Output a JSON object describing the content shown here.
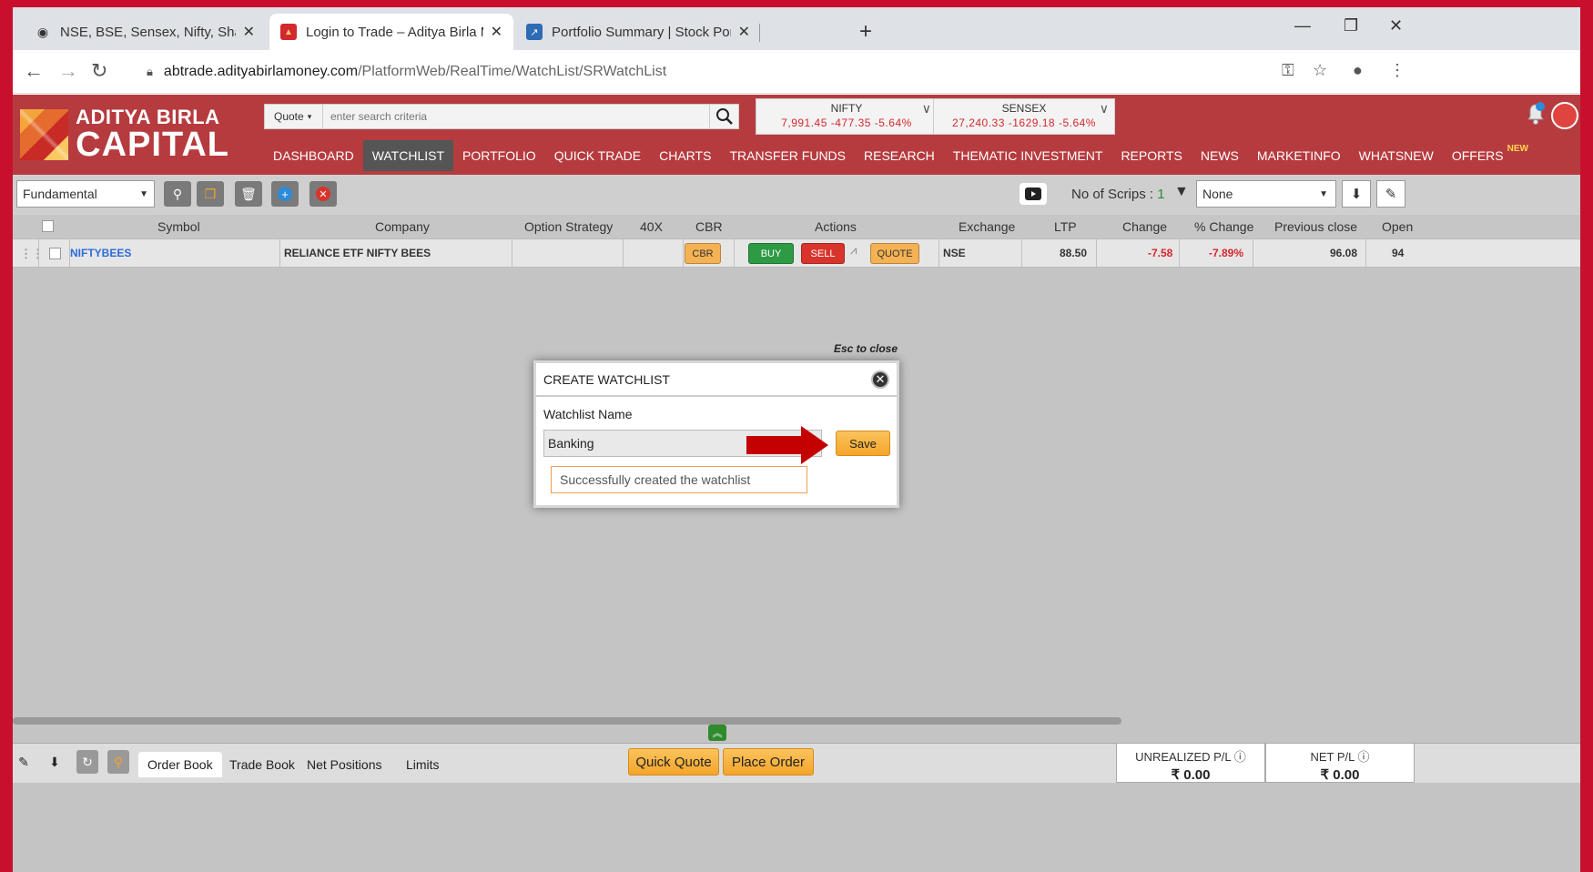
{
  "browser": {
    "tabs": [
      {
        "title": "NSE, BSE, Sensex, Nifty, Share Ma",
        "icon": "globe-icon"
      },
      {
        "title": "Login to Trade – Aditya Birla Mo",
        "icon": "aditya-birla-icon"
      },
      {
        "title": "Portfolio Summary | Stock Portfol",
        "icon": "chart-icon"
      }
    ],
    "url_host": "abtrade.adityabirlamoney.com",
    "url_path": "/PlatformWeb/RealTime/WatchList/SRWatchList"
  },
  "header": {
    "logo_line1": "ADITYA BIRLA",
    "logo_line2": "CAPITAL",
    "search_type": "Quote",
    "search_placeholder": "enter search criteria",
    "indices": [
      {
        "name": "NIFTY",
        "values": "7,991.45  -477.35  -5.64%"
      },
      {
        "name": "SENSEX",
        "values": "27,240.33  -1629.18  -5.64%"
      }
    ],
    "nav": [
      "DASHBOARD",
      "WATCHLIST",
      "PORTFOLIO",
      "QUICK TRADE",
      "CHARTS",
      "TRANSFER FUNDS",
      "RESEARCH",
      "THEMATIC INVESTMENT",
      "REPORTS",
      "NEWS",
      "MARKETINFO",
      "WHATSNEW",
      "OFFERS"
    ],
    "new_badge": "NEW",
    "bell_count": "3"
  },
  "toolbar": {
    "watchlist_selected": "Fundamental",
    "scrips_label": "No of Scrips : ",
    "scrips_count": "1",
    "filter_selected": "None"
  },
  "table": {
    "columns": [
      "Symbol",
      "Company",
      "Option Strategy",
      "40X",
      "CBR",
      "Actions",
      "Exchange",
      "LTP",
      "Change",
      "% Change",
      "Previous close",
      "Open"
    ],
    "rows": [
      {
        "symbol": "NIFTYBEES",
        "company": "RELIANCE ETF NIFTY BEES",
        "cbr_label": "CBR",
        "buy_label": "BUY",
        "sell_label": "SELL",
        "quote_label": "QUOTE",
        "exchange": "NSE",
        "ltp": "88.50",
        "change": "-7.58",
        "pct_change": "-7.89%",
        "prev_close": "96.08",
        "open": "94"
      }
    ]
  },
  "modal": {
    "esc_hint": "Esc to close",
    "title": "CREATE WATCHLIST",
    "name_label": "Watchlist Name",
    "name_value": "Banking",
    "save_label": "Save",
    "success_message": "Successfully created the watchlist"
  },
  "bottom": {
    "tabs": [
      "Order Book",
      "Trade Book",
      "Net Positions",
      "Limits"
    ],
    "quick_quote": "Quick Quote",
    "place_order": "Place Order",
    "unrealized_label": "UNREALIZED P/L",
    "unrealized_value": "₹ 0.00",
    "net_label": "NET P/L",
    "net_value": "₹ 0.00"
  },
  "colors": {
    "brand_red": "#b63b3f",
    "buy_green": "#2e9a44",
    "sell_red": "#d9342b",
    "accent_orange": "#f4a52a",
    "negative": "#d2282f"
  }
}
